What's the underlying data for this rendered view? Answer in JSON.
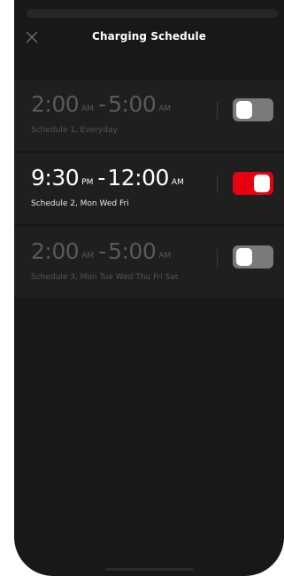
{
  "header": {
    "title": "Charging Schedule",
    "close_icon": "close-icon"
  },
  "colors": {
    "background": "#181818",
    "row_background": "#1f1f1f",
    "toggle_on": "#e60012",
    "toggle_off": "#7a7a7a"
  },
  "schedules": [
    {
      "start_time": "2:00",
      "start_period": "AM",
      "separator": "-",
      "end_time": "5:00",
      "end_period": "AM",
      "label": "Schedule 1, Everyday",
      "enabled": false
    },
    {
      "start_time": "9:30",
      "start_period": "PM",
      "separator": "-",
      "end_time": "12:00",
      "end_period": "AM",
      "label": "Schedule 2, Mon Wed Fri",
      "enabled": true
    },
    {
      "start_time": "2:00",
      "start_period": "AM",
      "separator": "-",
      "end_time": "5:00",
      "end_period": "AM",
      "label": "Schedule 3, Mon Tue Wed Thu Fri Sat",
      "enabled": false
    }
  ]
}
